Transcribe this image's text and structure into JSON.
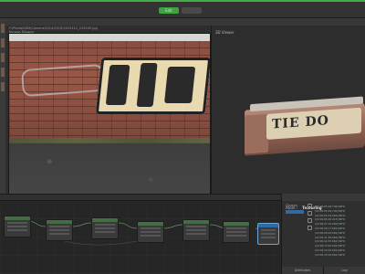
{
  "topbar": {
    "mode_active": "Edit",
    "mode_inactive": ""
  },
  "image_viewer": {
    "title": "Image Viewer",
    "path": "F:/Photo/DSM/Camera/2014/2015/2015412_104545.jpg",
    "zoom": "0.19x",
    "format": "JPG",
    "frame": "4032x3024",
    "image_select": "Image"
  },
  "viewer3d": {
    "title": "3D Viewer",
    "mesh_text": "TIE DO"
  },
  "attributes": {
    "title": "Texturing",
    "prefix": "Atom :",
    "chunks_label": "Chunks",
    "log_lines": [
      "[22:09:05.28:706] INFO",
      "[22:09:05.29:740] INFO",
      "[22:09:05.34:002] INFO",
      "[22:09:05.40:415] INFO",
      "[22:09:07.15:060] INFO",
      "[22:09:08.17:062] INFO",
      "[22:09:09.20:062] INFO",
      "[22:09:11.30:062] INFO",
      "[22:09:12.33:062] INFO",
      "[22:09:13.50:062] INFO",
      "[22:09:14.55:062] INFO",
      "[22:09:15.58:062] INFO"
    ],
    "tabs": [
      "Attributes",
      "Log"
    ]
  },
  "colors": {
    "accent": "#46a846",
    "selected_node": "#2f6aa0"
  }
}
